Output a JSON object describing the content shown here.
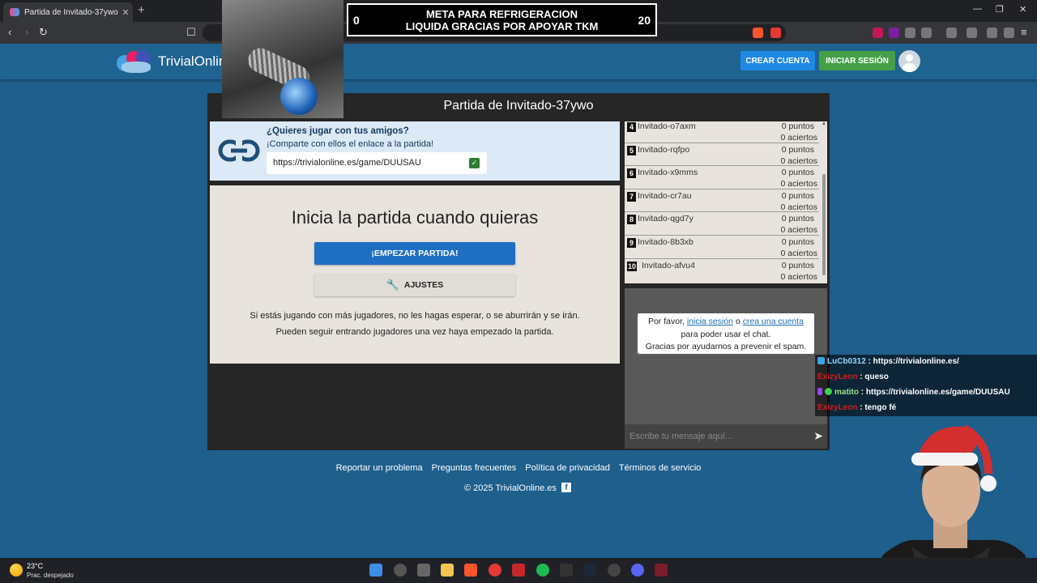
{
  "browser": {
    "tab_title": "Partida de Invitado-37ywo"
  },
  "site": {
    "logo_text": "TrivialOnline",
    "create_account": "CREAR CUENTA",
    "login": "INICIAR SESIÓN"
  },
  "overlay": {
    "goal_min": "0",
    "goal_max": "20",
    "goal_line1": "META PARA REFRIGERACION",
    "goal_line2": "LIQUIDA GRACIAS POR APOYAR TKM"
  },
  "game": {
    "title": "Partida de Invitado-37ywo",
    "invite_question": "¿Quieres jugar con tus amigos?",
    "invite_share": "¡Comparte con ellos el enlace a la partida!",
    "invite_url": "https://trivialonline.es/game/DUUSAU",
    "start_title": "Inicia la partida cuando quieras",
    "start_button": "¡EMPEZAR PARTIDA!",
    "settings_button": "AJUSTES",
    "note_line1": "Si estás jugando con más jugadores, no les hagas esperar, o se aburrirán y se irán.",
    "note_line2": "Pueden seguir entrando jugadores una vez haya empezado la partida."
  },
  "players": [
    {
      "num": "4",
      "name": "Invitado-o7axm",
      "points": "0 puntos",
      "hits": "0 aciertos"
    },
    {
      "num": "5",
      "name": "Invitado-rqfpo",
      "points": "0 puntos",
      "hits": "0 aciertos"
    },
    {
      "num": "6",
      "name": "Invitado-x9mms",
      "points": "0 puntos",
      "hits": "0 aciertos"
    },
    {
      "num": "7",
      "name": "Invitado-cr7au",
      "points": "0 puntos",
      "hits": "0 aciertos"
    },
    {
      "num": "8",
      "name": "Invitado-qgd7y",
      "points": "0 puntos",
      "hits": "0 aciertos"
    },
    {
      "num": "9",
      "name": "Invitado-8b3xb",
      "points": "0 puntos",
      "hits": "0 aciertos"
    },
    {
      "num": "10",
      "name": "Invitado-afvu4",
      "points": "0 puntos",
      "hits": "0 aciertos"
    }
  ],
  "chat": {
    "notice_pre": "Por favor, ",
    "notice_login": "inicia sesión",
    "notice_or": " o ",
    "notice_create": "crea una cuenta",
    "notice_line2": "para poder usar el chat.",
    "notice_line3": "Gracias por ayudarnos a prevenir el spam.",
    "input_placeholder": "Escribe tu mensaje aquí..."
  },
  "footer": {
    "links": [
      "Reportar un problema",
      "Preguntas frecuentes",
      "Política de privacidad",
      "Términos de servicio"
    ],
    "copyright": "© 2025 TrivialOnline.es"
  },
  "stream_chat": [
    {
      "user": "LuCb0312",
      "text": " : https://trivialonline.es/",
      "color": "#8fd8ff",
      "badge": "#3aa6e8"
    },
    {
      "user": "ExizyLeon",
      "text": " : queso",
      "color": "#d81b1b",
      "badge": ""
    },
    {
      "user": "matito",
      "text": " : https://trivialonline.es/game/DUUSAU",
      "color": "#9be08a",
      "badge": "#9146ff"
    },
    {
      "user": "ExizyLeon",
      "text": " : tengo fé",
      "color": "#d81b1b",
      "badge": ""
    }
  ],
  "taskbar": {
    "temp": "23°C",
    "weather": "Prac. despejado"
  },
  "colors": {
    "site_bg": "#1e5f8c",
    "create_btn": "#1e88e5",
    "login_btn": "#43a047",
    "start_btn": "#1f6fc5"
  }
}
